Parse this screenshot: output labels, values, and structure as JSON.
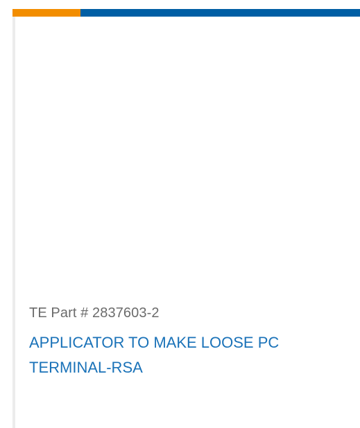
{
  "product_card": {
    "accent_colors": {
      "orange": "#f28d00",
      "blue": "#005ea4"
    },
    "part_number": "TE Part # 2837603-2",
    "title": "APPLICATOR TO MAKE LOOSE PC TERMINAL-RSA",
    "title_color": "#1a72b8"
  }
}
